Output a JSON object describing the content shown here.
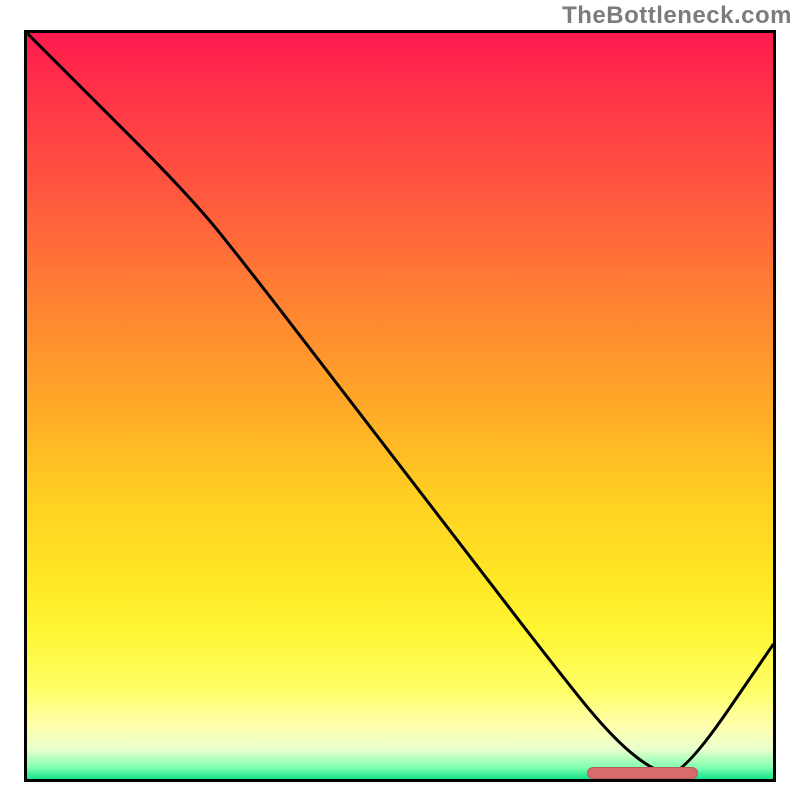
{
  "watermark": "TheBottleneck.com",
  "colors": {
    "curve": "#000000",
    "bar": "#d86b6b",
    "border": "#000000"
  },
  "chart_data": {
    "type": "line",
    "title": "",
    "xlabel": "",
    "ylabel": "",
    "xlim": [
      0,
      100
    ],
    "ylim": [
      0,
      100
    ],
    "series": [
      {
        "name": "bottleneck-curve",
        "x": [
          0,
          5,
          22,
          30,
          40,
          50,
          60,
          70,
          78,
          84,
          88,
          100
        ],
        "y": [
          100,
          95,
          78,
          68,
          55,
          42,
          29,
          16,
          6,
          1,
          0.5,
          18
        ]
      }
    ],
    "annotations": [
      {
        "name": "optimal-range-bar",
        "x_start": 75,
        "x_end": 90,
        "y": 0.8
      }
    ]
  }
}
